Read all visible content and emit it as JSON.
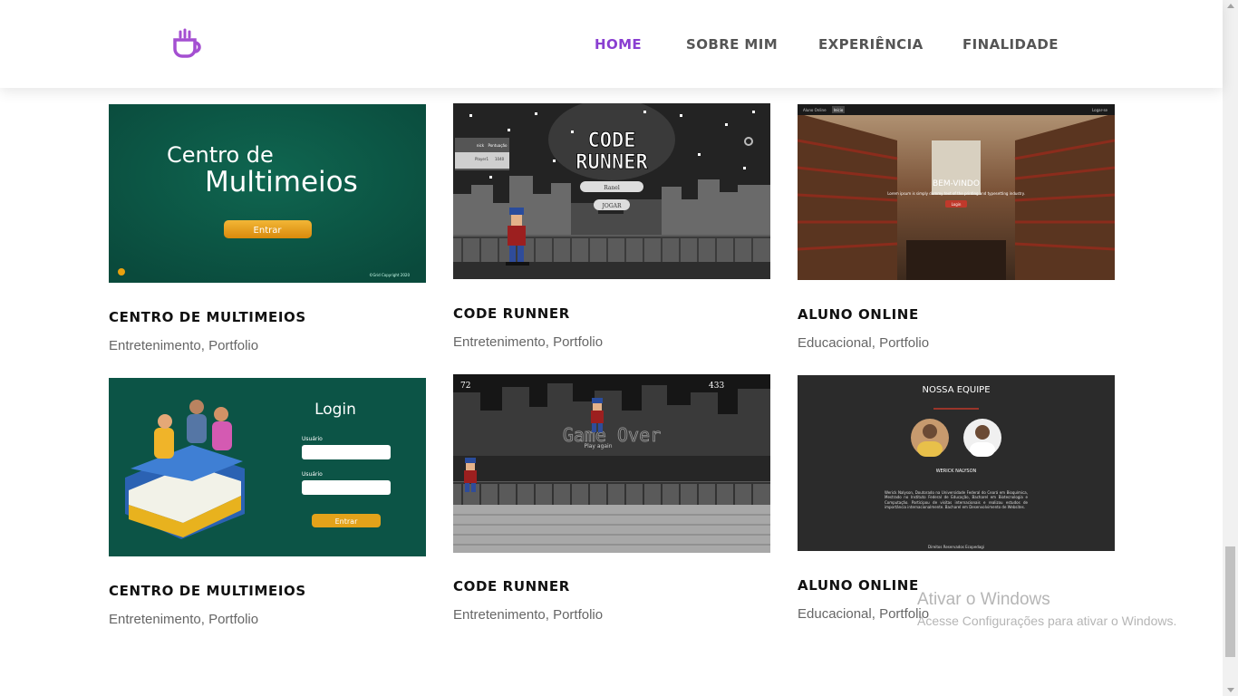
{
  "header": {
    "logo_icon": "coffee-cup-icon",
    "nav": [
      "HOME",
      "SOBRE MIM",
      "EXPERIÊNCIA",
      "FINALIDADE"
    ],
    "active": "HOME",
    "accent": "#8a3fd1"
  },
  "projects": [
    {
      "title": "CENTRO DE MULTIMEIOS",
      "categories": [
        "Entretenimento",
        "Portfolio"
      ],
      "thumb": {
        "title_line1": "Centro de",
        "title_line2": "Multimeios",
        "button": "Entrar",
        "footer": "©Grid Copyright 2020"
      }
    },
    {
      "title": "CODE RUNNER",
      "categories": [
        "Entretenimento",
        "Portfolio"
      ],
      "thumb": {
        "logo_line1": "CODE",
        "logo_line2": "RUNNER",
        "input": "Ranel",
        "button": "JOGAR",
        "col1": "nick",
        "col2": "Pontuação",
        "row_name": "Player1",
        "row_score": "1040"
      }
    },
    {
      "title": "ALUNO ONLINE",
      "categories": [
        "Educacional",
        "Portfolio"
      ],
      "thumb": {
        "brand": "Aluno Online",
        "tab": "Início",
        "login": "Logar-se",
        "heading": "BEM-VINDO",
        "text": "Lorem ipsum is simply dummy text of the printing and typesetting industry.",
        "button": "Login"
      }
    },
    {
      "title": "CENTRO DE MULTIMEIOS",
      "categories": [
        "Entretenimento",
        "Portfolio"
      ],
      "thumb": {
        "heading": "Login",
        "label1": "Usuário",
        "label2": "Usuário",
        "button": "Entrar"
      }
    },
    {
      "title": "CODE RUNNER",
      "categories": [
        "Entretenimento",
        "Portfolio"
      ],
      "thumb": {
        "score_left": "72",
        "score_right": "433",
        "heading": "Game Over",
        "sub": "Play again"
      }
    },
    {
      "title": "ALUNO ONLINE",
      "categories": [
        "Educacional",
        "Portfolio"
      ],
      "thumb": {
        "heading": "NOSSA EQUIPE",
        "name": "WERICK NALYSON",
        "bio": "Werick Nalyson, Doutorado na Universidade Federal do Ceará em Bioquímica, Mestrado no Instituto Federal de Educação, Bacharel em Biotecnologia e Computação. Participou de visitas internacionais e realizou estudos de importância internacionalmente. Bacharel em Desenvolvimento de Websites.",
        "footer": "Direitos Reservados Ecopedagi"
      }
    }
  ],
  "watermark": {
    "line1": "Ativar o Windows",
    "line2": "Acesse Configurações para ativar o Windows."
  }
}
